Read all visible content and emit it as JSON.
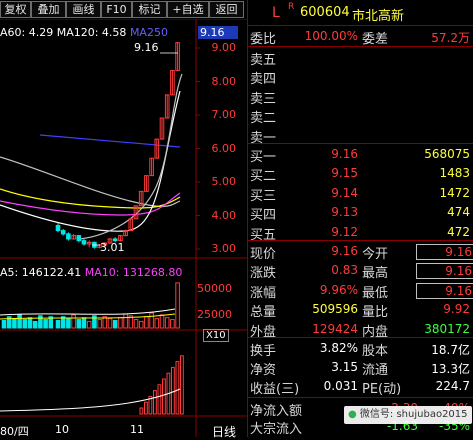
{
  "toolbar": {
    "items": [
      "复权",
      "叠加",
      "画线",
      "F10",
      "标记",
      "+自选",
      "返回"
    ]
  },
  "chart": {
    "ma_legend": {
      "ma60": "A60: 4.29",
      "ma120": "MA120: 4.58",
      "ma250": "MA250"
    },
    "price_ticks": [
      "9.00",
      "8.00",
      "7.00",
      "6.00",
      "5.00",
      "4.00",
      "3.00"
    ],
    "current_price_tag": "9.16",
    "high_label": "9.16",
    "low_label": "3.01",
    "vol_legend": {
      "v": "A5: 146122.41",
      "ma10": "MA10: 131268.80"
    },
    "vol_ticks": [
      "50000",
      "25000"
    ],
    "vol_unit": "X10",
    "bottom_tabs": {
      "a": "80/四",
      "b": "10",
      "c": "11"
    },
    "period_label": "日线",
    "candles": [
      {
        "o": 3.7,
        "c": 3.55,
        "h": 3.78,
        "l": 3.5
      },
      {
        "o": 3.55,
        "c": 3.45,
        "h": 3.6,
        "l": 3.4
      },
      {
        "o": 3.45,
        "c": 3.3,
        "h": 3.5,
        "l": 3.25
      },
      {
        "o": 3.3,
        "c": 3.4,
        "h": 3.45,
        "l": 3.28
      },
      {
        "o": 3.4,
        "c": 3.25,
        "h": 3.42,
        "l": 3.2
      },
      {
        "o": 3.25,
        "c": 3.15,
        "h": 3.3,
        "l": 3.1
      },
      {
        "o": 3.15,
        "c": 3.2,
        "h": 3.25,
        "l": 3.05
      },
      {
        "o": 3.2,
        "c": 3.05,
        "h": 3.22,
        "l": 3.01
      },
      {
        "o": 3.05,
        "c": 3.12,
        "h": 3.15,
        "l": 3.02
      },
      {
        "o": 3.12,
        "c": 3.18,
        "h": 3.2,
        "l": 3.08
      },
      {
        "o": 3.18,
        "c": 3.3,
        "h": 3.32,
        "l": 3.15
      },
      {
        "o": 3.3,
        "c": 3.25,
        "h": 3.35,
        "l": 3.2
      },
      {
        "o": 3.25,
        "c": 3.4,
        "h": 3.42,
        "l": 3.22
      },
      {
        "o": 3.4,
        "c": 3.55,
        "h": 3.58,
        "l": 3.38
      },
      {
        "o": 3.55,
        "c": 3.9,
        "h": 3.92,
        "l": 3.55
      },
      {
        "o": 3.9,
        "c": 4.29,
        "h": 4.29,
        "l": 3.9
      },
      {
        "o": 4.29,
        "c": 4.72,
        "h": 4.72,
        "l": 4.29
      },
      {
        "o": 4.72,
        "c": 5.19,
        "h": 5.19,
        "l": 4.72
      },
      {
        "o": 5.19,
        "c": 5.71,
        "h": 5.71,
        "l": 5.19
      },
      {
        "o": 5.71,
        "c": 6.28,
        "h": 6.28,
        "l": 5.71
      },
      {
        "o": 6.28,
        "c": 6.91,
        "h": 6.91,
        "l": 6.28
      },
      {
        "o": 6.91,
        "c": 7.6,
        "h": 7.6,
        "l": 6.91
      },
      {
        "o": 7.6,
        "c": 8.33,
        "h": 8.33,
        "l": 7.6
      },
      {
        "o": 8.33,
        "c": 9.16,
        "h": 9.16,
        "l": 8.33
      }
    ],
    "volumes": [
      8,
      12,
      10,
      14,
      9,
      11,
      7,
      13,
      9,
      12,
      10,
      8,
      11,
      15,
      13,
      9,
      7,
      12,
      16,
      10,
      14,
      11,
      9,
      48
    ]
  },
  "quote": {
    "code_marker": "L",
    "r_marker": "R",
    "code": "600604",
    "name": "市北高新",
    "weibi_label": "委比",
    "weibi_value": "100.00%",
    "weicha_label": "委差",
    "weicha_value": "57.2万",
    "sells": [
      {
        "label": "卖五",
        "price": "",
        "vol": ""
      },
      {
        "label": "卖四",
        "price": "",
        "vol": ""
      },
      {
        "label": "卖三",
        "price": "",
        "vol": ""
      },
      {
        "label": "卖二",
        "price": "",
        "vol": ""
      },
      {
        "label": "卖一",
        "price": "",
        "vol": ""
      }
    ],
    "buys": [
      {
        "label": "买一",
        "price": "9.16",
        "vol": "568075"
      },
      {
        "label": "买二",
        "price": "9.15",
        "vol": "1483"
      },
      {
        "label": "买三",
        "price": "9.14",
        "vol": "1472"
      },
      {
        "label": "买四",
        "price": "9.13",
        "vol": "474"
      },
      {
        "label": "买五",
        "price": "9.12",
        "vol": "472"
      }
    ],
    "stats": [
      {
        "l1": "现价",
        "v1": "9.16",
        "l2": "今开",
        "v2": "9.16"
      },
      {
        "l1": "涨跌",
        "v1": "0.83",
        "l2": "最高",
        "v2": "9.16"
      },
      {
        "l1": "涨幅",
        "v1": "9.96%",
        "l2": "最低",
        "v2": "9.16"
      },
      {
        "l1": "总量",
        "v1": "509596",
        "l2": "量比",
        "v2": "9.92"
      },
      {
        "l1": "外盘",
        "v1": "129424",
        "l2": "内盘",
        "v2": "380172"
      }
    ],
    "stats2": [
      {
        "l1": "换手",
        "v1": "3.82%",
        "l2": "股本",
        "v2": "18.7亿"
      },
      {
        "l1": "净资",
        "v1": "3.15",
        "l2": "流通",
        "v2": "13.3亿"
      },
      {
        "l1": "收益(三)",
        "v1": "0.031",
        "l2": "PE(动)",
        "v2": "224.7"
      }
    ],
    "flow": [
      {
        "label": "净流入额",
        "v1": "2.30",
        "v2": "49%"
      },
      {
        "label": "大宗流入",
        "v1": "-1.63",
        "v2": "-35%"
      }
    ],
    "watermark": "微信号: shujubao2015"
  }
}
